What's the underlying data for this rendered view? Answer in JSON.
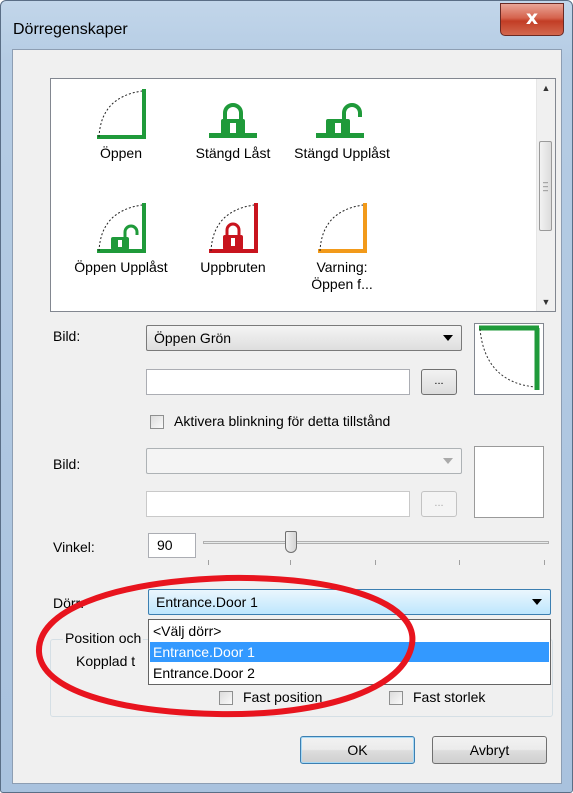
{
  "window": {
    "title": "Dörregenskaper",
    "close_label": "x"
  },
  "states": [
    {
      "label": "Öppen",
      "icon": "door-open-green-icon"
    },
    {
      "label": "Stängd Låst",
      "icon": "lock-locked-green-icon"
    },
    {
      "label": "Stängd Upplåst",
      "icon": "lock-unlocked-green-icon"
    },
    {
      "label": "Öppen Upplåst",
      "icon": "door-open-unlocked-green-icon"
    },
    {
      "label": "Uppbruten",
      "icon": "door-forced-red-icon"
    },
    {
      "label": "Varning: Öppen f...",
      "icon": "door-open-orange-icon"
    }
  ],
  "image1": {
    "label": "Bild:",
    "value": "Öppen Grön",
    "text": "",
    "browse": "..."
  },
  "blink": {
    "label": "Aktivera blinkning för detta tillstånd",
    "checked": false
  },
  "image2": {
    "label": "Bild:",
    "value": "",
    "text": "",
    "browse": "..."
  },
  "angle": {
    "label": "Vinkel:",
    "value": "90"
  },
  "door": {
    "label": "Dörr:",
    "value": "Entrance.Door 1",
    "options": [
      "<Välj dörr>",
      "Entrance.Door 1",
      "Entrance.Door 2"
    ],
    "selected_index": 1
  },
  "position_group": {
    "title": "Position och",
    "linked_label": "Kopplad t",
    "fixed_position": "Fast position",
    "fixed_size": "Fast storlek"
  },
  "buttons": {
    "ok": "OK",
    "cancel": "Avbryt"
  },
  "colors": {
    "green": "#1f9a3a",
    "red": "#c8141e",
    "orange": "#f29a1a",
    "highlight": "#3399ff",
    "annotation": "#e8141e"
  }
}
